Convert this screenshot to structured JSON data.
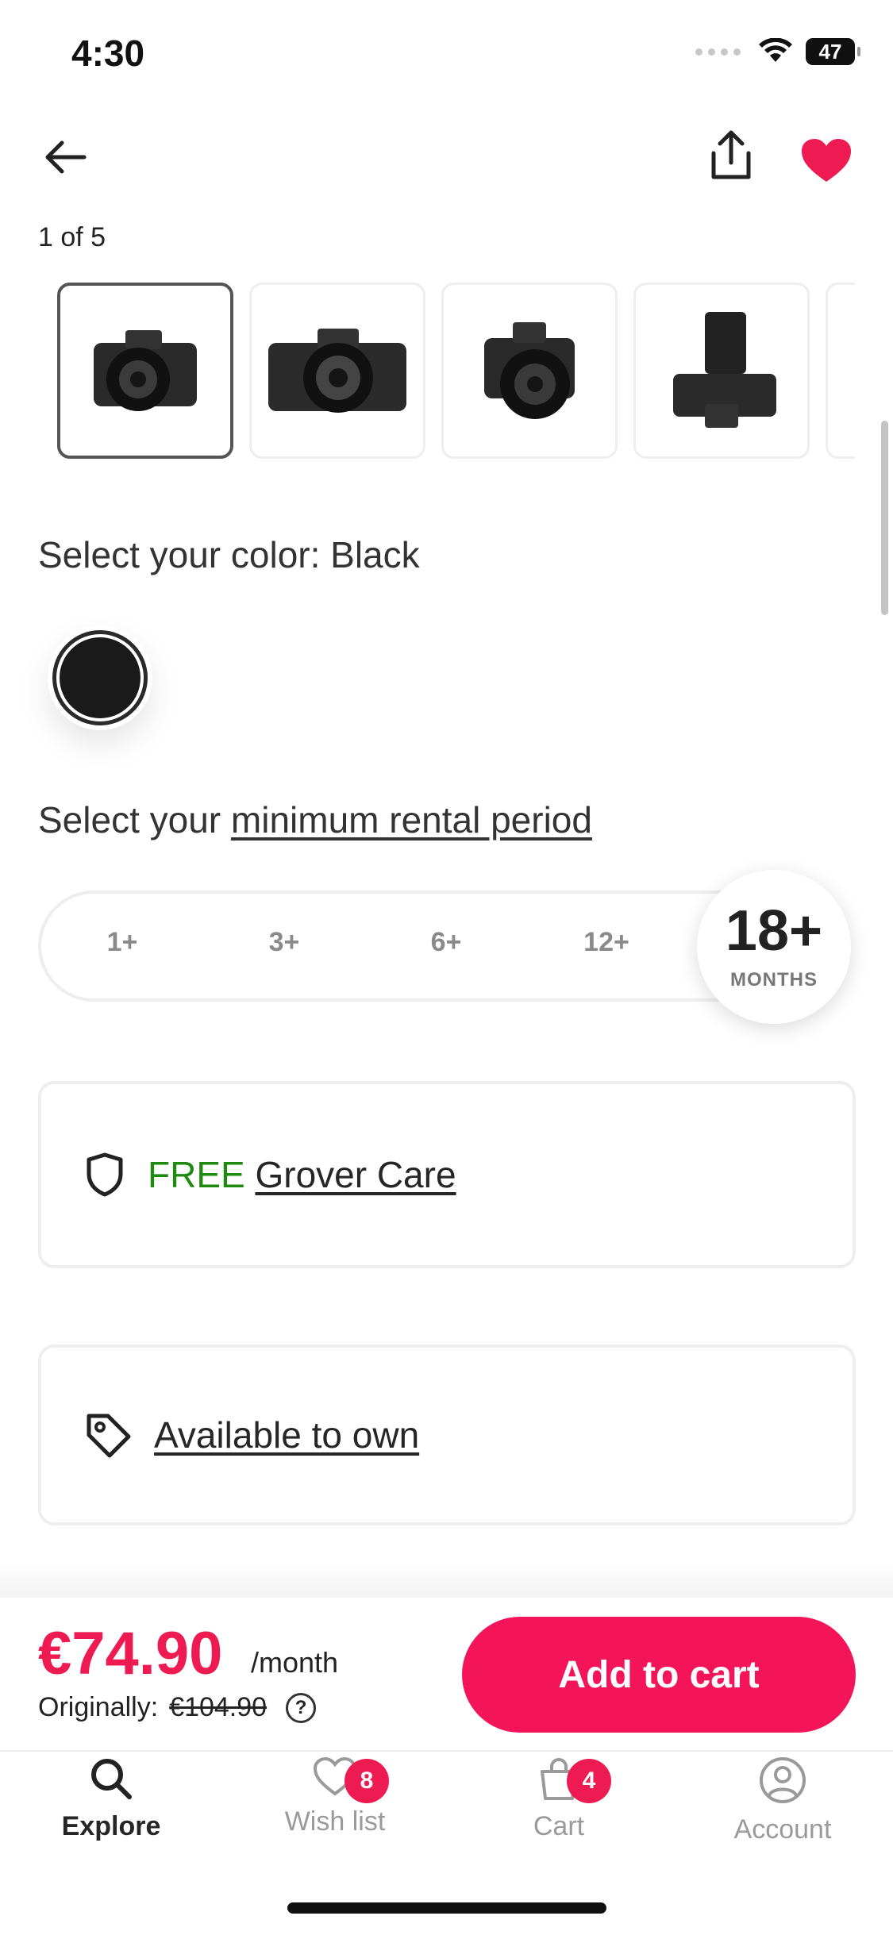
{
  "status_bar": {
    "time": "4:30",
    "battery": "47"
  },
  "gallery": {
    "counter": "1 of 5",
    "thumbnails": [
      "camera-front-angled",
      "camera-front",
      "camera-front-lens",
      "camera-top"
    ]
  },
  "color_section": {
    "label": "Select your color: Black",
    "selected_color": "#1a1a1a"
  },
  "rental_period": {
    "prefix": "Select your ",
    "link_text": "minimum rental period",
    "options": [
      "1+",
      "3+",
      "6+",
      "12+"
    ],
    "selected": "18+",
    "selected_unit": "MONTHS"
  },
  "care_card": {
    "free": "FREE",
    "link": "Grover Care",
    "icon": "shield-icon"
  },
  "own_card": {
    "link": "Available to own",
    "icon": "tag-icon"
  },
  "pricing": {
    "price": "€74.90",
    "per": "/month",
    "original_label": "Originally:",
    "original_price": "€104.90",
    "cta": "Add to cart"
  },
  "tabs": [
    {
      "label": "Explore",
      "icon": "search-icon",
      "active": true
    },
    {
      "label": "Wish list",
      "icon": "heart-icon",
      "badge": "8"
    },
    {
      "label": "Cart",
      "icon": "bag-icon",
      "badge": "4"
    },
    {
      "label": "Account",
      "icon": "user-icon"
    }
  ],
  "colors": {
    "accent": "#ee1b52",
    "cta": "#f4145a",
    "free_green": "#1f8a10"
  }
}
